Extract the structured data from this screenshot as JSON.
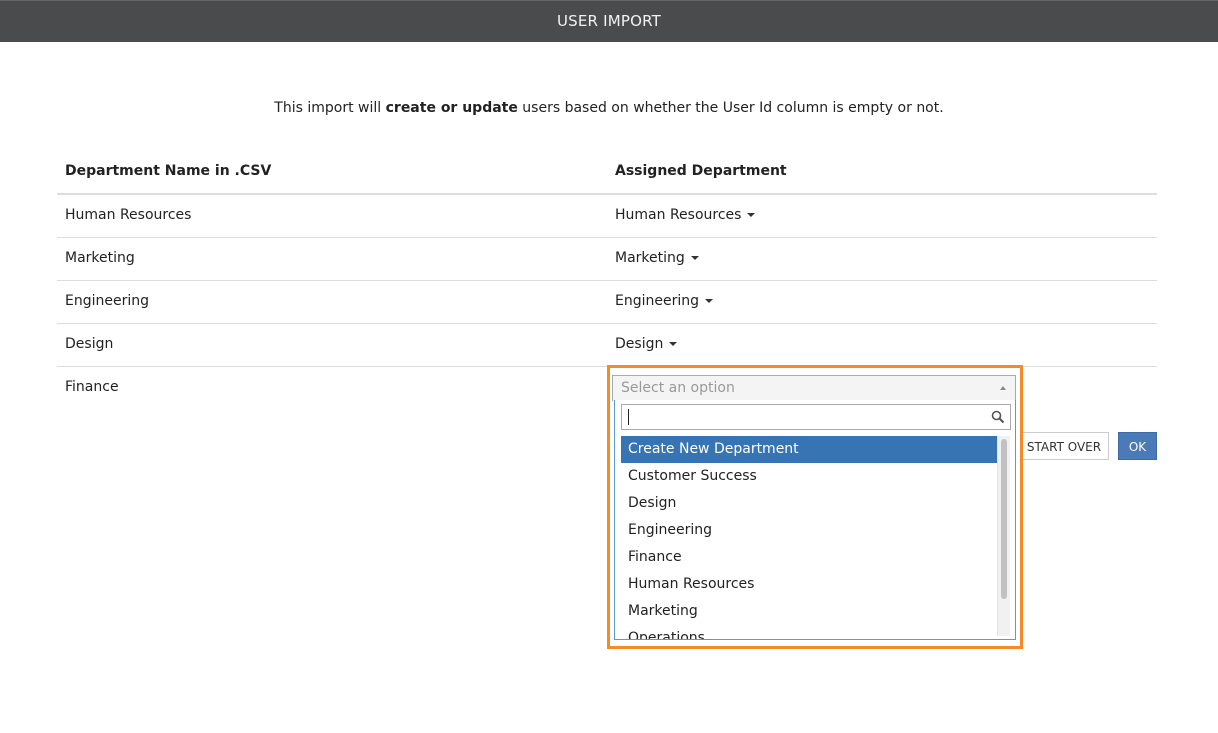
{
  "window": {
    "title": "USER IMPORT"
  },
  "intro": {
    "prefix": "This import will ",
    "bold": "create or update",
    "suffix": " users based on whether the User Id column is empty or not."
  },
  "table": {
    "headers": [
      "Department Name in .CSV",
      "Assigned Department"
    ],
    "rows": [
      {
        "csv": "Human Resources",
        "assigned": "Human Resources"
      },
      {
        "csv": "Marketing",
        "assigned": "Marketing"
      },
      {
        "csv": "Engineering",
        "assigned": "Engineering"
      },
      {
        "csv": "Design",
        "assigned": "Design"
      },
      {
        "csv": "Finance",
        "assigned": ""
      }
    ]
  },
  "select": {
    "placeholder": "Select an option",
    "search_value": "",
    "options": [
      "Create New Department",
      "Customer Success",
      "Design",
      "Engineering",
      "Finance",
      "Human Resources",
      "Marketing",
      "Operations"
    ],
    "highlighted_option": "Create New Department"
  },
  "buttons": {
    "start_over": "START OVER",
    "ok": "OK"
  },
  "colors": {
    "titlebar": "#4a4b4c",
    "highlight_border": "#f58b26",
    "selected_option": "#3674b4",
    "ok_button": "#4a7ab8"
  },
  "icons": {
    "search": "magnifier-icon",
    "caret": "caret-down-icon"
  }
}
